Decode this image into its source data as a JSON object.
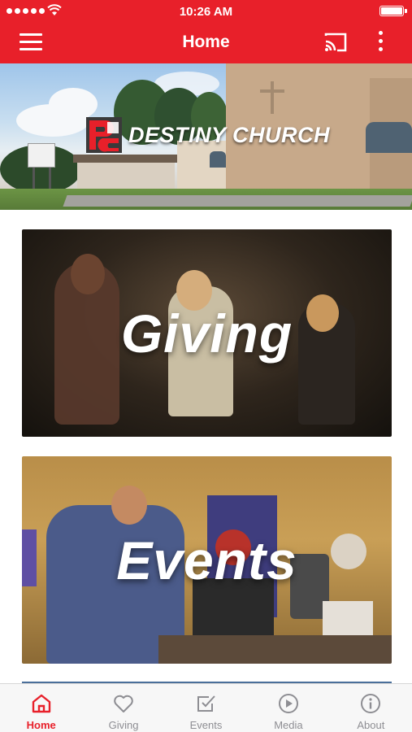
{
  "status_bar": {
    "time": "10:26 AM",
    "signal_icon": "signal-dots-icon",
    "wifi_icon": "wifi-icon",
    "battery_icon": "battery-icon"
  },
  "nav_bar": {
    "title": "Home",
    "menu_icon": "hamburger-menu-icon",
    "cast_icon": "cast-icon",
    "more_icon": "more-vertical-icon",
    "background_color": "#e8202a"
  },
  "hero": {
    "logo_text": "DESTINY CHURCH",
    "logo_icon": "destiny-church-logo"
  },
  "cards": [
    {
      "label": "Giving"
    },
    {
      "label": "Events"
    }
  ],
  "tab_bar": {
    "active_color": "#e8202a",
    "inactive_color": "#8e8e93",
    "items": [
      {
        "label": "Home",
        "icon": "home-icon",
        "active": true
      },
      {
        "label": "Giving",
        "icon": "heart-icon",
        "active": false
      },
      {
        "label": "Events",
        "icon": "checkbox-icon",
        "active": false
      },
      {
        "label": "Media",
        "icon": "play-circle-icon",
        "active": false
      },
      {
        "label": "About",
        "icon": "info-circle-icon",
        "active": false
      }
    ]
  }
}
